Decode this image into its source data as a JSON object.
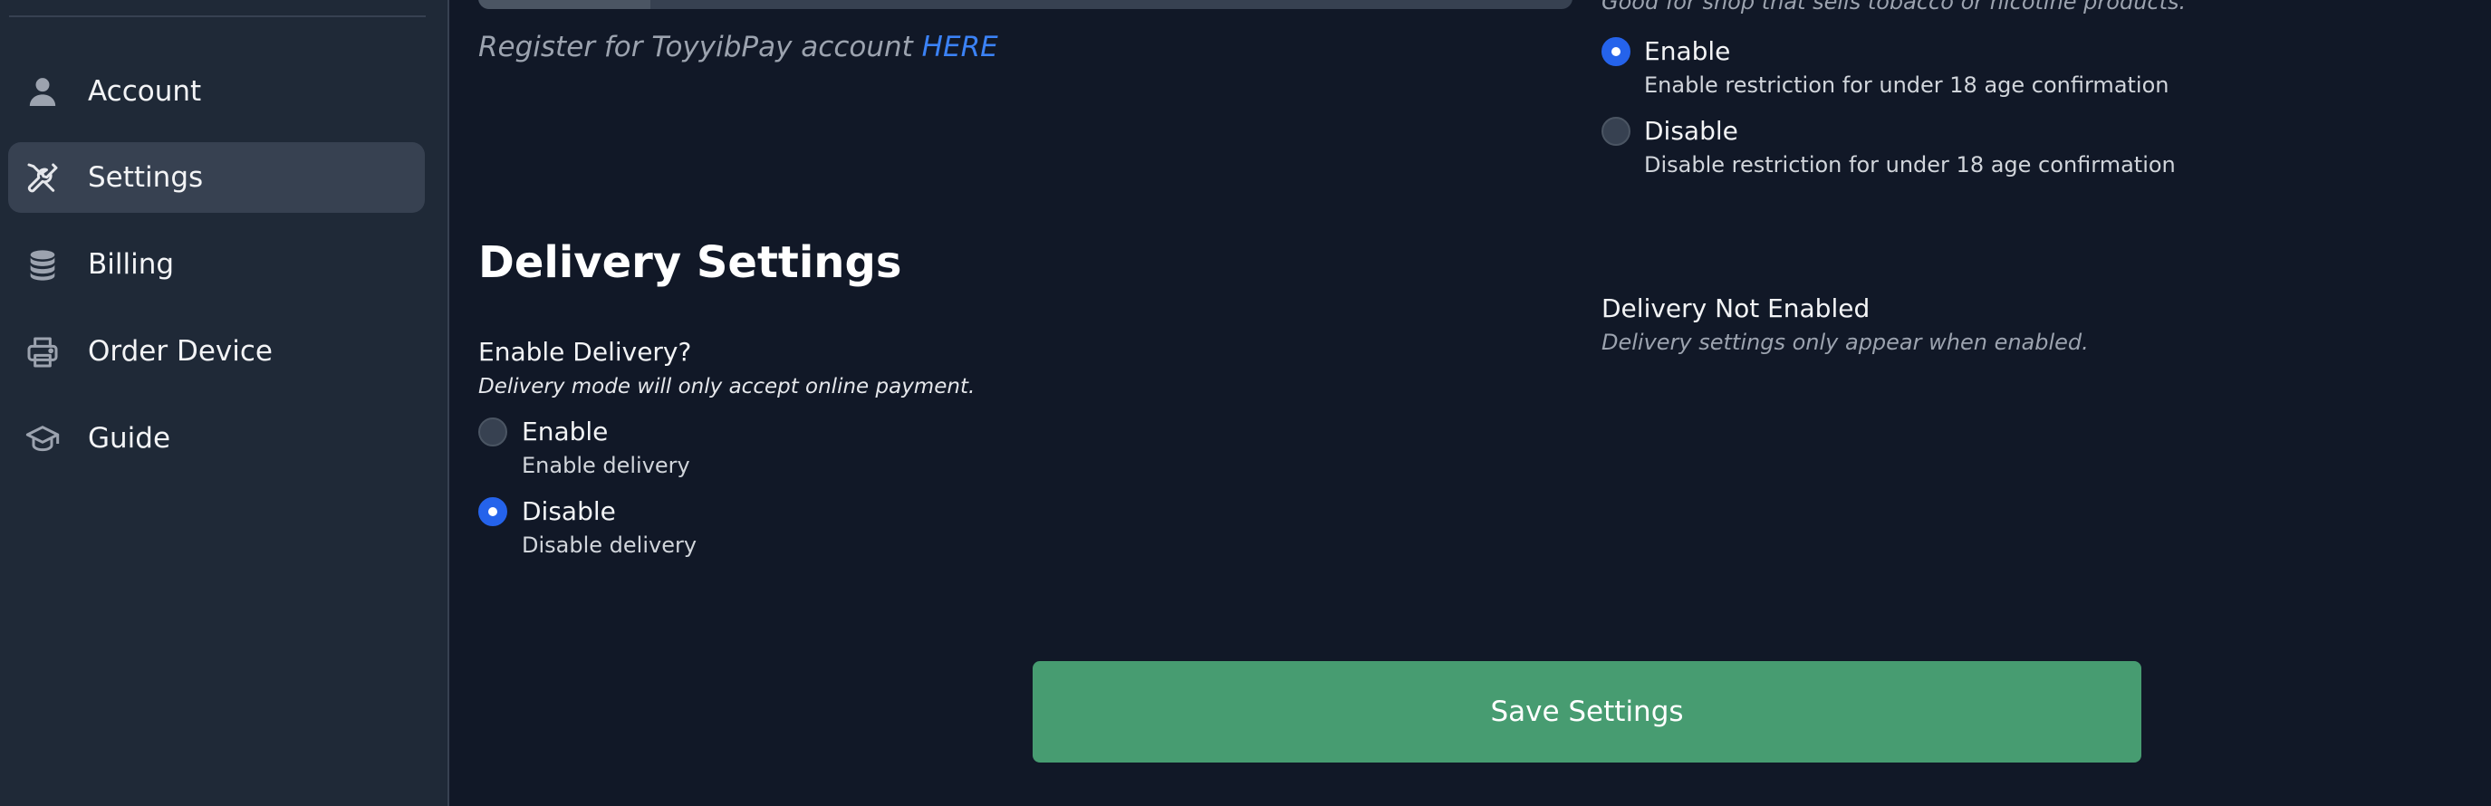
{
  "sidebar": {
    "items": [
      {
        "label": "Account",
        "icon": "user-icon"
      },
      {
        "label": "Settings",
        "icon": "tools-icon",
        "active": true
      },
      {
        "label": "Billing",
        "icon": "coin-stack-icon"
      },
      {
        "label": "Order Device",
        "icon": "printer-icon"
      },
      {
        "label": "Guide",
        "icon": "graduation-cap-icon"
      }
    ]
  },
  "payment": {
    "register_text": "Register for ToyyibPay account",
    "register_link": "HERE"
  },
  "age_restriction": {
    "help_text": "Good for shop that sells tobacco or nicotine products.",
    "options": [
      {
        "label": "Enable",
        "description": "Enable restriction for under 18 age confirmation",
        "checked": true
      },
      {
        "label": "Disable",
        "description": "Disable restriction for under 18 age confirmation",
        "checked": false
      }
    ]
  },
  "delivery": {
    "title": "Delivery Settings",
    "field_label": "Enable Delivery?",
    "field_help": "Delivery mode will only accept online payment.",
    "options": [
      {
        "label": "Enable",
        "description": "Enable delivery",
        "checked": false
      },
      {
        "label": "Disable",
        "description": "Disable delivery",
        "checked": true
      }
    ],
    "not_enabled_title": "Delivery Not Enabled",
    "not_enabled_help": "Delivery settings only appear when enabled."
  },
  "actions": {
    "save_label": "Save Settings"
  },
  "colors": {
    "accent": "#2563eb",
    "link": "#3b82f6",
    "save": "#479c71",
    "sidebar_bg": "#1f2937",
    "main_bg": "#111827"
  }
}
